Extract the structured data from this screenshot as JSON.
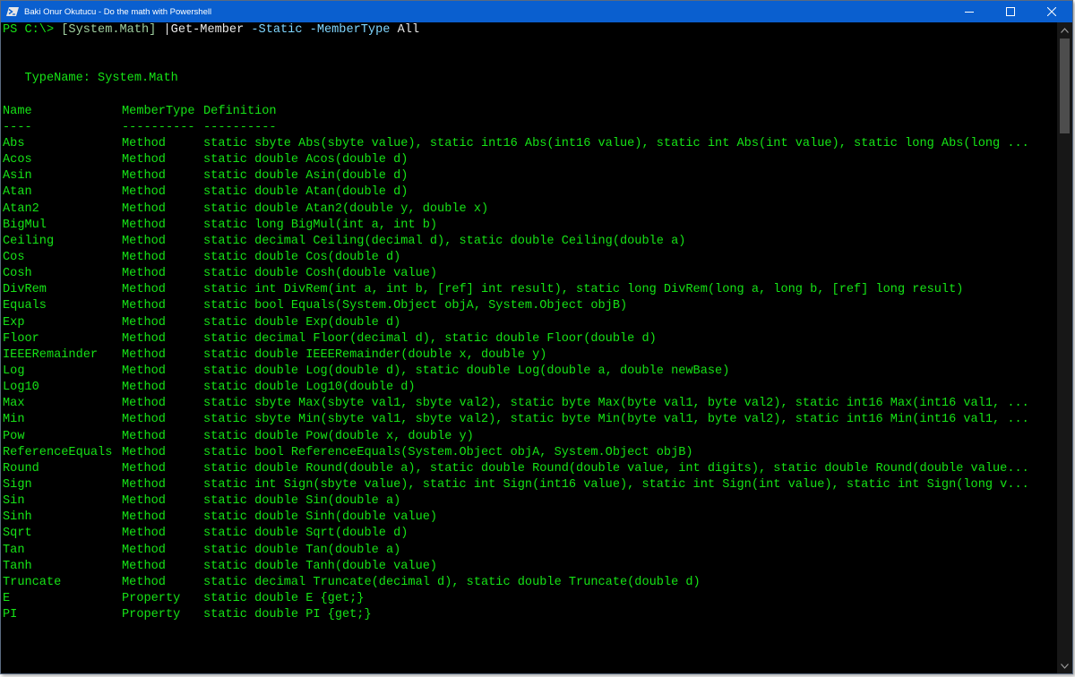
{
  "window": {
    "title": "Baki Onur Okutucu - Do the math with Powershell",
    "icon": "powershell-icon",
    "colors": {
      "titlebar": "#0a5fcf",
      "console_bg": "#000000",
      "console_text": "#16e316"
    }
  },
  "prompt": {
    "ps": "PS C:\\> ",
    "type": "[System.Math]",
    "pipe": " |",
    "cmdlet": "Get-Member",
    "param1": " -Static",
    "param2": " -MemberType",
    "value": " All"
  },
  "typename": "   TypeName: System.Math",
  "headers": {
    "name": "Name",
    "membertype": "MemberType",
    "definition": "Definition"
  },
  "underline": {
    "name": "----",
    "membertype": "----------",
    "definition": "----------"
  },
  "members": [
    {
      "name": "Abs",
      "type": "Method",
      "def": "static sbyte Abs(sbyte value), static int16 Abs(int16 value), static int Abs(int value), static long Abs(long ..."
    },
    {
      "name": "Acos",
      "type": "Method",
      "def": "static double Acos(double d)"
    },
    {
      "name": "Asin",
      "type": "Method",
      "def": "static double Asin(double d)"
    },
    {
      "name": "Atan",
      "type": "Method",
      "def": "static double Atan(double d)"
    },
    {
      "name": "Atan2",
      "type": "Method",
      "def": "static double Atan2(double y, double x)"
    },
    {
      "name": "BigMul",
      "type": "Method",
      "def": "static long BigMul(int a, int b)"
    },
    {
      "name": "Ceiling",
      "type": "Method",
      "def": "static decimal Ceiling(decimal d), static double Ceiling(double a)"
    },
    {
      "name": "Cos",
      "type": "Method",
      "def": "static double Cos(double d)"
    },
    {
      "name": "Cosh",
      "type": "Method",
      "def": "static double Cosh(double value)"
    },
    {
      "name": "DivRem",
      "type": "Method",
      "def": "static int DivRem(int a, int b, [ref] int result), static long DivRem(long a, long b, [ref] long result)"
    },
    {
      "name": "Equals",
      "type": "Method",
      "def": "static bool Equals(System.Object objA, System.Object objB)"
    },
    {
      "name": "Exp",
      "type": "Method",
      "def": "static double Exp(double d)"
    },
    {
      "name": "Floor",
      "type": "Method",
      "def": "static decimal Floor(decimal d), static double Floor(double d)"
    },
    {
      "name": "IEEERemainder",
      "type": "Method",
      "def": "static double IEEERemainder(double x, double y)"
    },
    {
      "name": "Log",
      "type": "Method",
      "def": "static double Log(double d), static double Log(double a, double newBase)"
    },
    {
      "name": "Log10",
      "type": "Method",
      "def": "static double Log10(double d)"
    },
    {
      "name": "Max",
      "type": "Method",
      "def": "static sbyte Max(sbyte val1, sbyte val2), static byte Max(byte val1, byte val2), static int16 Max(int16 val1, ..."
    },
    {
      "name": "Min",
      "type": "Method",
      "def": "static sbyte Min(sbyte val1, sbyte val2), static byte Min(byte val1, byte val2), static int16 Min(int16 val1, ..."
    },
    {
      "name": "Pow",
      "type": "Method",
      "def": "static double Pow(double x, double y)"
    },
    {
      "name": "ReferenceEquals",
      "type": "Method",
      "def": "static bool ReferenceEquals(System.Object objA, System.Object objB)"
    },
    {
      "name": "Round",
      "type": "Method",
      "def": "static double Round(double a), static double Round(double value, int digits), static double Round(double value..."
    },
    {
      "name": "Sign",
      "type": "Method",
      "def": "static int Sign(sbyte value), static int Sign(int16 value), static int Sign(int value), static int Sign(long v..."
    },
    {
      "name": "Sin",
      "type": "Method",
      "def": "static double Sin(double a)"
    },
    {
      "name": "Sinh",
      "type": "Method",
      "def": "static double Sinh(double value)"
    },
    {
      "name": "Sqrt",
      "type": "Method",
      "def": "static double Sqrt(double d)"
    },
    {
      "name": "Tan",
      "type": "Method",
      "def": "static double Tan(double a)"
    },
    {
      "name": "Tanh",
      "type": "Method",
      "def": "static double Tanh(double value)"
    },
    {
      "name": "Truncate",
      "type": "Method",
      "def": "static decimal Truncate(decimal d), static double Truncate(double d)"
    },
    {
      "name": "E",
      "type": "Property",
      "def": "static double E {get;}"
    },
    {
      "name": "PI",
      "type": "Property",
      "def": "static double PI {get;}"
    }
  ]
}
